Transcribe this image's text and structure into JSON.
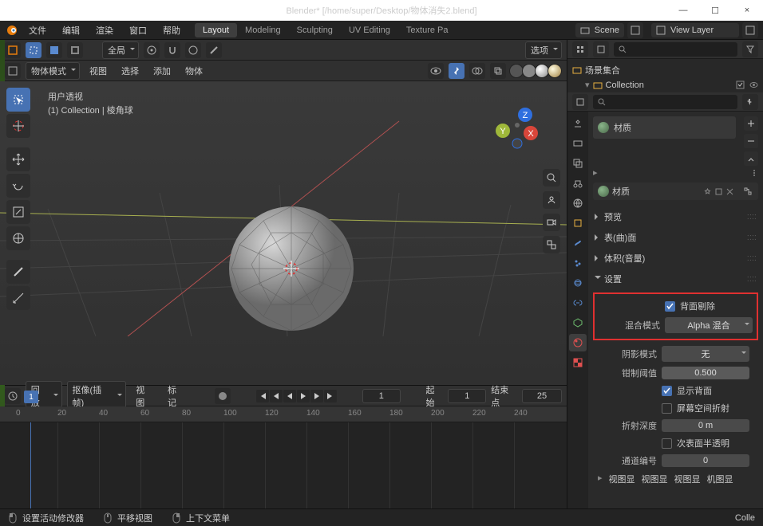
{
  "window": {
    "title": "Blender* [/home/super/Desktop/物体消失2.blend]",
    "min": "—",
    "max": "☐",
    "close": "×"
  },
  "topmenu": {
    "items": [
      "文件",
      "编辑",
      "渲染",
      "窗口",
      "帮助"
    ],
    "tabs": [
      "Layout",
      "Modeling",
      "Sculpting",
      "UV Editing",
      "Texture Pa"
    ],
    "active_tab": "Layout",
    "scene_label": "Scene",
    "viewlayer_label": "View Layer"
  },
  "viewport": {
    "options_label": "选项",
    "mode_label": "物体模式",
    "pivot_label": "全局",
    "header2": [
      "视图",
      "选择",
      "添加",
      "物体"
    ],
    "info_line1": "用户透视",
    "info_line2": "(1) Collection | 棱角球",
    "gizmo_axes": {
      "x": "X",
      "y": "Y",
      "z": "Z"
    }
  },
  "timeline": {
    "playback_label": "回放",
    "keying_label": "抠像(插帧)",
    "view_label": "视图",
    "marker_label": "标记",
    "frame_current": 1,
    "start_label": "起始",
    "start": 1,
    "end_label": "结束点",
    "end": 25,
    "ticks": [
      0,
      20,
      40,
      60,
      80,
      100,
      120,
      140,
      160,
      180,
      200,
      220,
      240
    ],
    "playhead_frame": "1"
  },
  "outliner": {
    "root": "场景集合",
    "collection": "Collection",
    "search_placeholder": ""
  },
  "properties": {
    "material_slot": "材质",
    "material_name": "材质",
    "nodes_label": "▸",
    "panels": {
      "preview": "预览",
      "surface": "表(曲)面",
      "volume": "体积(音量)",
      "settings": "设置"
    },
    "settings": {
      "backface_label": "背面剔除",
      "backface_on": true,
      "blend_label": "混合模式",
      "blend_value": "Alpha 混合",
      "shadow_label": "阴影模式",
      "shadow_value": "无",
      "clip_label": "钳制阈值",
      "clip_value": "0.500",
      "show_backface_label": "显示背面",
      "show_backface_on": true,
      "ssr_label": "屏幕空间折射",
      "ssr_on": false,
      "refract_depth_label": "折射深度",
      "refract_depth_value": "0 m",
      "subsurf_label": "次表面半透明",
      "subsurf_on": false,
      "pass_label": "通道编号",
      "pass_value": "0"
    },
    "footer_links": [
      "视图显",
      "视图显",
      "视图显",
      "机图显"
    ]
  },
  "statusbar": {
    "item1": "设置活动修改器",
    "item2": "平移视图",
    "item3": "上下文菜单",
    "right": "Colle"
  }
}
